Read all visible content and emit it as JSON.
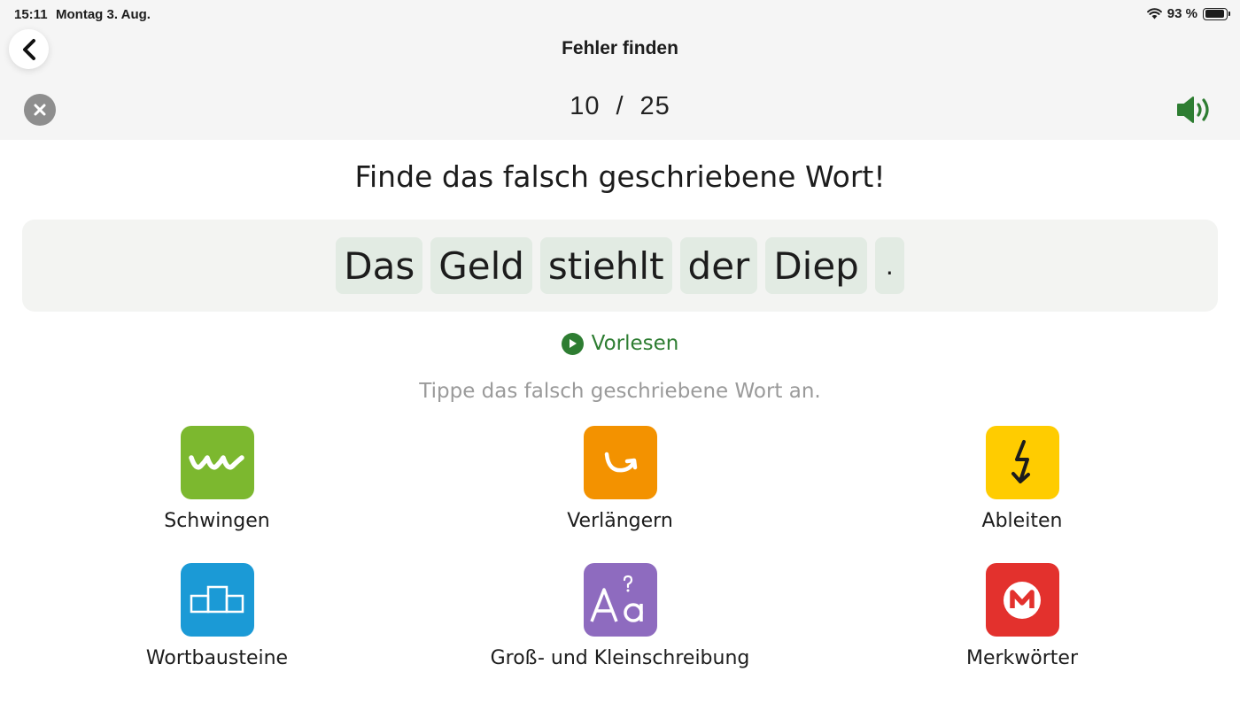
{
  "status": {
    "time": "15:11",
    "date": "Montag 3. Aug.",
    "battery": "93 %",
    "battery_level": 0.93
  },
  "header": {
    "title": "Fehler finden"
  },
  "progress": {
    "current": "10",
    "separator": "/",
    "total": "25"
  },
  "task": {
    "instruction": "Finde das falsch geschriebene Wort!",
    "words": [
      "Das",
      "Geld",
      "stiehlt",
      "der",
      "Diep",
      "."
    ],
    "read_aloud": "Vorlesen",
    "hint": "Tippe das falsch geschriebene Wort an."
  },
  "strategies": [
    {
      "label": "Schwingen",
      "icon": "wave-icon",
      "color": "#7cb82f"
    },
    {
      "label": "Verlängern",
      "icon": "curved-arrow-icon",
      "color": "#f39200"
    },
    {
      "label": "Ableiten",
      "icon": "lightning-arrow-icon",
      "color": "#ffcc00"
    },
    {
      "label": "Wortbausteine",
      "icon": "building-blocks-icon",
      "color": "#1b9ad6"
    },
    {
      "label": "Groß- und Kleinschreibung",
      "icon": "letter-case-icon",
      "color": "#8e6bbf"
    },
    {
      "label": "Merkwörter",
      "icon": "memo-m-icon",
      "color": "#e3312d"
    }
  ],
  "colors": {
    "accent_green": "#2e7d32",
    "word_tile": "#e2ebe3",
    "sentence_bg": "#f3f4f2"
  }
}
